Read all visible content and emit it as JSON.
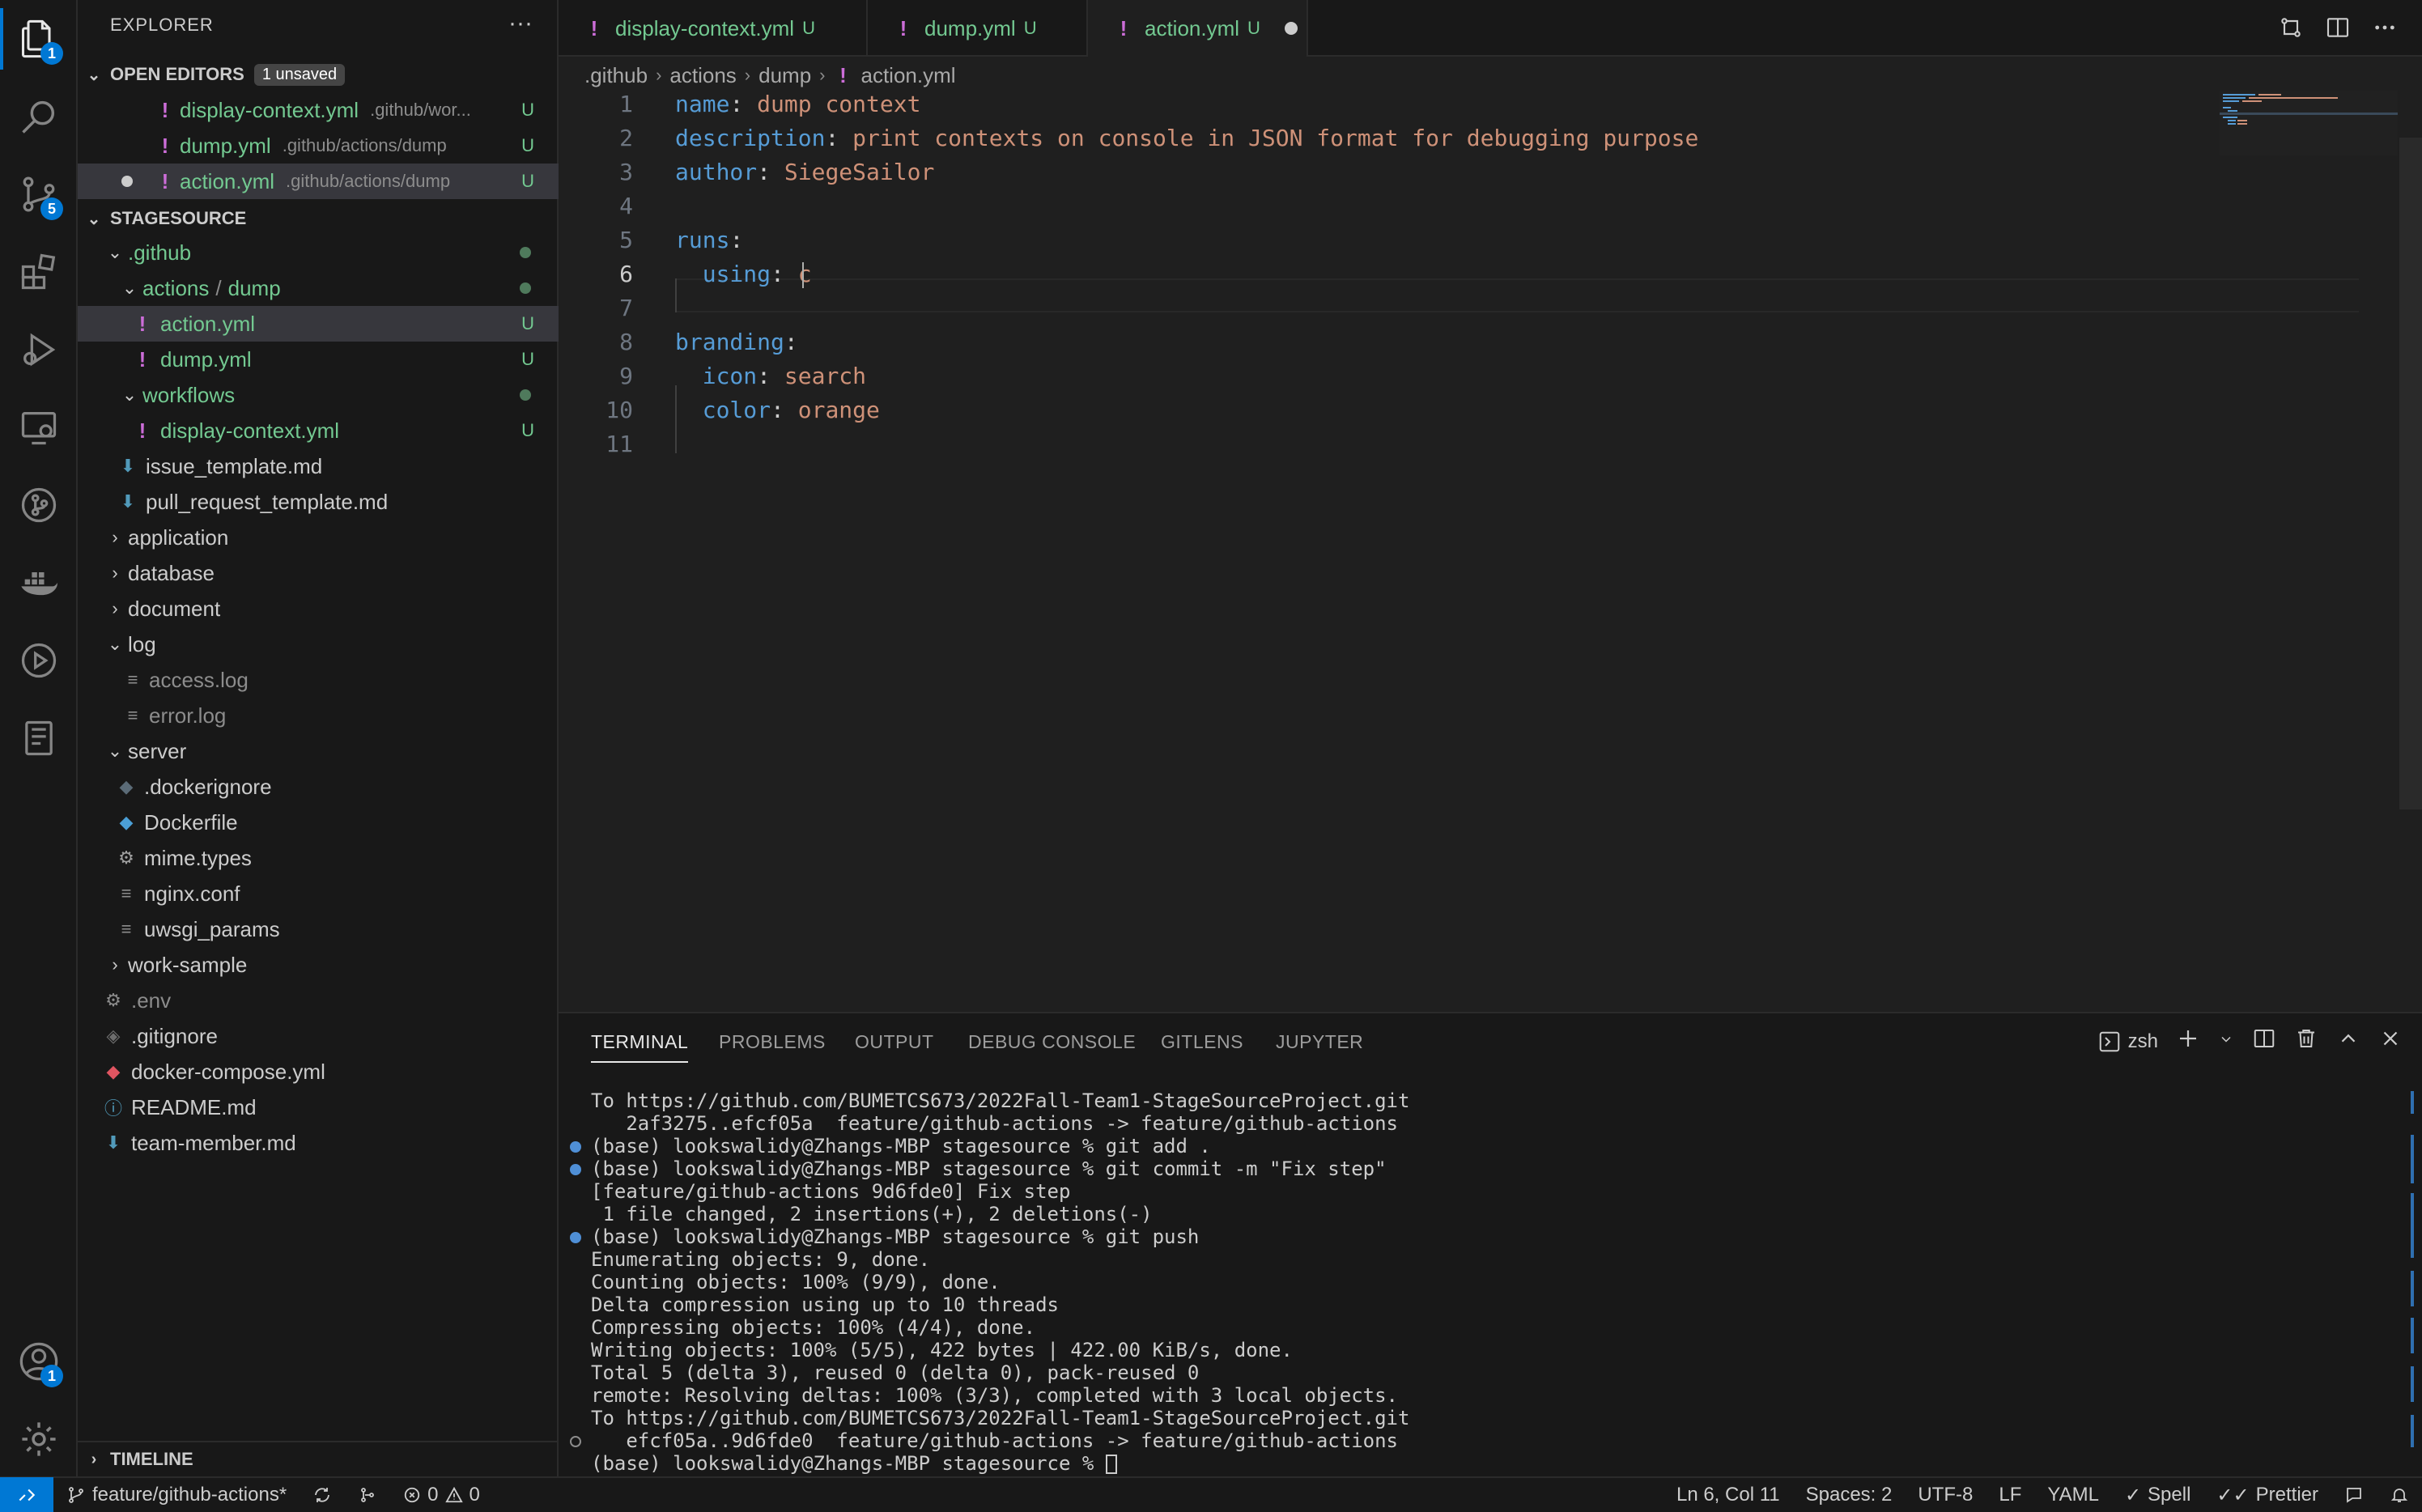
{
  "activity": {
    "explorer_badge": "1",
    "scm_badge": "5",
    "accounts_badge": "1"
  },
  "sidebar": {
    "title": "EXPLORER",
    "more": "···",
    "open_editors": {
      "label": "OPEN EDITORS",
      "pill": "1 unsaved",
      "items": [
        {
          "name": "display-context.yml",
          "path": ".github/wor...",
          "status": "U"
        },
        {
          "name": "dump.yml",
          "path": ".github/actions/dump",
          "status": "U"
        },
        {
          "name": "action.yml",
          "path": ".github/actions/dump",
          "status": "U"
        }
      ]
    },
    "workspace": {
      "label": "STAGESOURCE",
      "tree": [
        ".github",
        "actions",
        "dump",
        "action.yml",
        "dump.yml",
        "workflows",
        "display-context.yml",
        "issue_template.md",
        "pull_request_template.md",
        "application",
        "database",
        "document",
        "log",
        "access.log",
        "error.log",
        "server",
        ".dockerignore",
        "Dockerfile",
        "mime.types",
        "nginx.conf",
        "uwsgi_params",
        "work-sample",
        ".env",
        ".gitignore",
        "docker-compose.yml",
        "README.md",
        "team-member.md"
      ],
      "status_u": "U",
      "path_sep": "/"
    },
    "timeline": "TIMELINE"
  },
  "tabs": [
    {
      "name": "display-context.yml",
      "status": "U"
    },
    {
      "name": "dump.yml",
      "status": "U"
    },
    {
      "name": "action.yml",
      "status": "U"
    }
  ],
  "breadcrumb": [
    ".github",
    "actions",
    "dump",
    "action.yml"
  ],
  "editor": {
    "line_numbers": [
      "1",
      "2",
      "3",
      "4",
      "5",
      "6",
      "7",
      "8",
      "9",
      "10",
      "11"
    ],
    "l1k": "name",
    "l1v": "dump context",
    "l2k": "description",
    "l2v": "print contexts on console in JSON format for debugging purpose",
    "l3k": "author",
    "l3v": "SiegeSailor",
    "l5k": "runs",
    "l6k": "using",
    "l6v": "c",
    "l8k": "branding",
    "l9k": "icon",
    "l9v": "search",
    "l10k": "color",
    "l10v": "orange",
    "colon": ":"
  },
  "panel": {
    "tabs": [
      "TERMINAL",
      "PROBLEMS",
      "OUTPUT",
      "DEBUG CONSOLE",
      "GITLENS",
      "JUPYTER"
    ],
    "shell": "zsh",
    "lines": [
      "To https://github.com/BUMETCS673/2022Fall-Team1-StageSourceProject.git",
      "   2af3275..efcf05a  feature/github-actions -> feature/github-actions",
      "(base) lookswalidy@Zhangs-MBP stagesource % git add .",
      "(base) lookswalidy@Zhangs-MBP stagesource % git commit -m \"Fix step\"",
      "[feature/github-actions 9d6fde0] Fix step",
      " 1 file changed, 2 insertions(+), 2 deletions(-)",
      "(base) lookswalidy@Zhangs-MBP stagesource % git push",
      "Enumerating objects: 9, done.",
      "Counting objects: 100% (9/9), done.",
      "Delta compression using up to 10 threads",
      "Compressing objects: 100% (4/4), done.",
      "Writing objects: 100% (5/5), 422 bytes | 422.00 KiB/s, done.",
      "Total 5 (delta 3), reused 0 (delta 0), pack-reused 0",
      "remote: Resolving deltas: 100% (3/3), completed with 3 local objects.",
      "To https://github.com/BUMETCS673/2022Fall-Team1-StageSourceProject.git",
      "   efcf05a..9d6fde0  feature/github-actions -> feature/github-actions",
      "(base) lookswalidy@Zhangs-MBP stagesource % "
    ]
  },
  "statusbar": {
    "branch": "feature/github-actions*",
    "errors": "0",
    "warnings": "0",
    "position": "Ln 6, Col 11",
    "spaces": "Spaces: 2",
    "encoding": "UTF-8",
    "eol": "LF",
    "language": "YAML",
    "spell": "Spell",
    "prettier": "Prettier"
  },
  "colors": {
    "accent": "#0078d4",
    "untracked": "#73c991",
    "yaml_key": "#569cd6",
    "yaml_value": "#ce9178",
    "yaml_icon": "#cc6dd8"
  }
}
